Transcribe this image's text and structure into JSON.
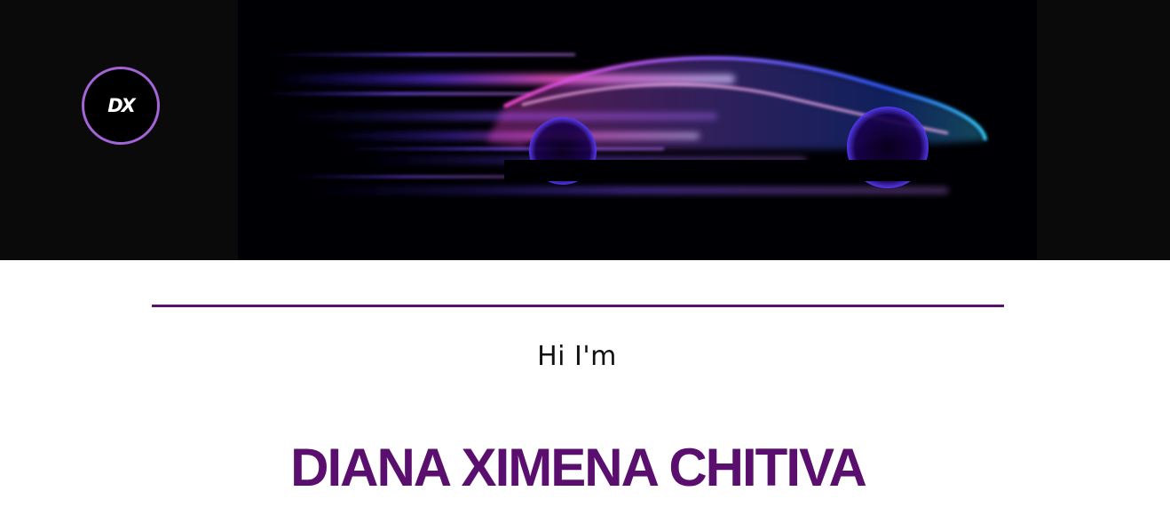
{
  "header": {
    "logo_text": "DX",
    "banner_image": "neon-sports-car"
  },
  "hero": {
    "greeting": "Hi I'm",
    "name": "DIANA XIMENA CHITIVA"
  },
  "colors": {
    "accent": "#5a0f6e",
    "logo_ring": "#a264d6",
    "header_bg": "#0a0a0a"
  }
}
